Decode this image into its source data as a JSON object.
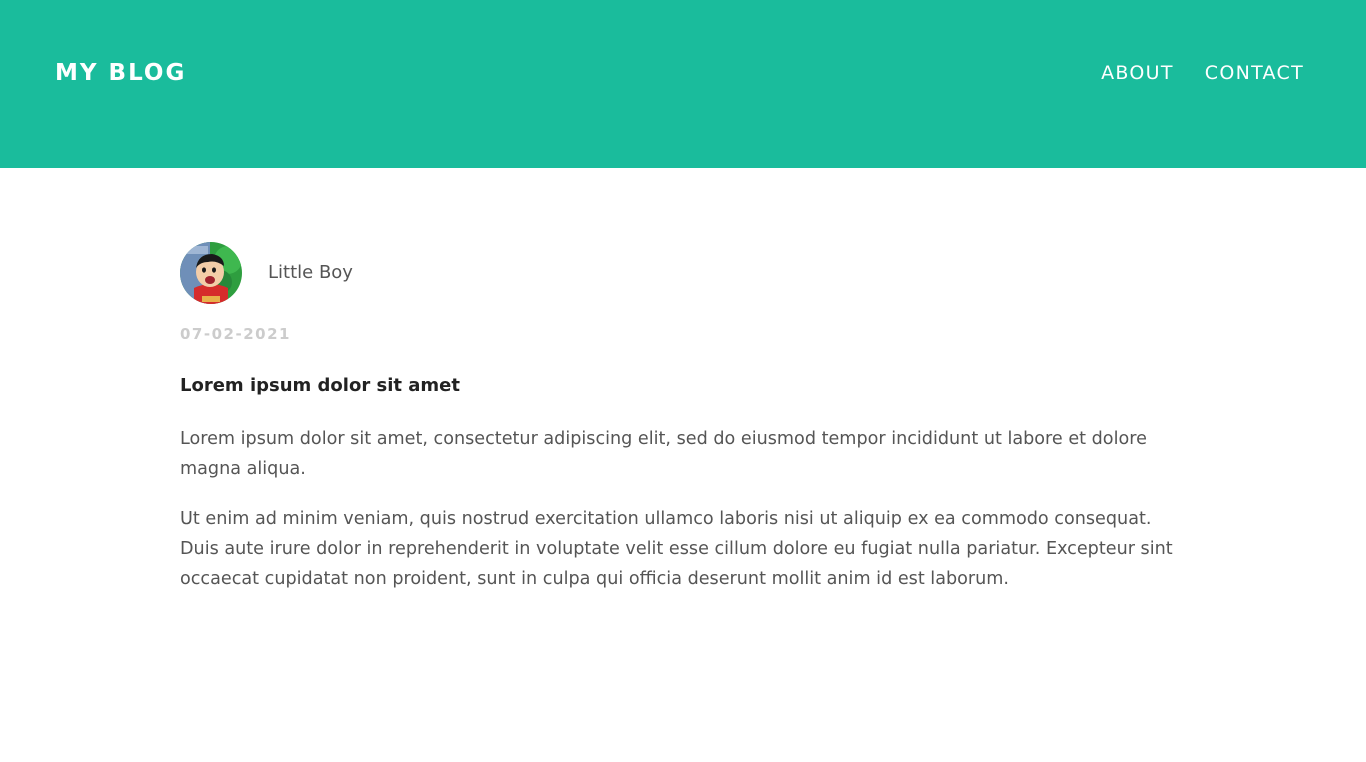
{
  "header": {
    "brand": "MY BLOG",
    "nav": [
      {
        "label": "ABOUT"
      },
      {
        "label": "CONTACT"
      }
    ],
    "background_color": "#1abc9c"
  },
  "post": {
    "author": {
      "name": "Little Boy",
      "avatar_icon": "cartoon-boy-avatar"
    },
    "date": "07-02-2021",
    "title": "Lorem ipsum dolor sit amet",
    "paragraphs": [
      "Lorem ipsum dolor sit amet, consectetur adipiscing elit, sed do eiusmod tempor incididunt ut labore et dolore magna aliqua.",
      "Ut enim ad minim veniam, quis nostrud exercitation ullamco laboris nisi ut aliquip ex ea commodo consequat. Duis aute irure dolor in reprehenderit in voluptate velit esse cillum dolore eu fugiat nulla pariatur. Excepteur sint occaecat cupidatat non proident, sunt in culpa qui officia deserunt mollit anim id est laborum."
    ]
  }
}
